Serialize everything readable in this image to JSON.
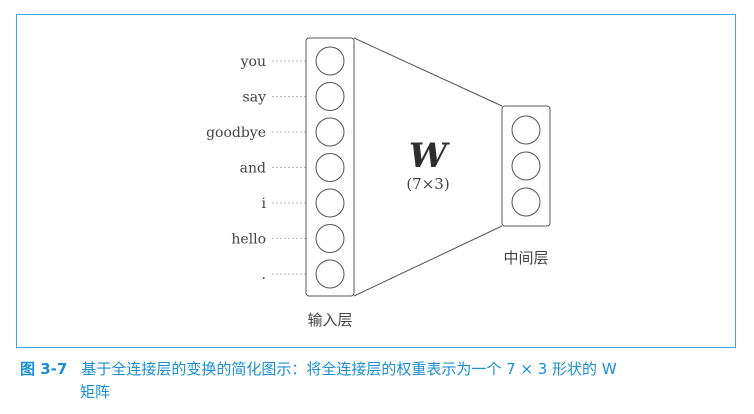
{
  "input_words": [
    "you",
    "say",
    "goodbye",
    "and",
    "i",
    "hello",
    "."
  ],
  "weight": {
    "symbol": "W",
    "shape": "(7×3)"
  },
  "input_layer_label": "输入层",
  "middle_layer_label": "中间层",
  "middle_neuron_count": 3,
  "caption": {
    "number": "图 3-7",
    "line1": "基于全连接层的变换的简化图示：将全连接层的权重表示为一个 7 × 3 形状的 W",
    "line2": "矩阵"
  },
  "colors": {
    "frame": "#3ba7dd",
    "caption": "#1a8fd2",
    "stroke": "#555555",
    "dashed": "#bbbbbb"
  }
}
